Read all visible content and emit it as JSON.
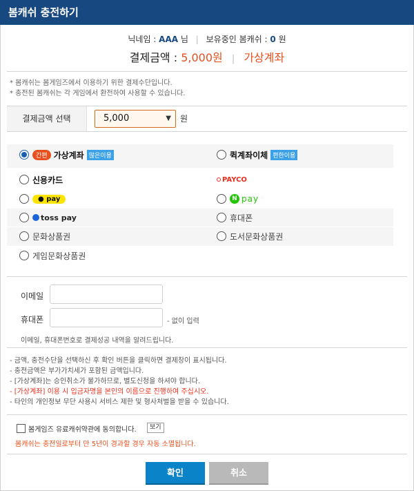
{
  "header": {
    "title": "봄캐쉬 충전하기"
  },
  "info": {
    "nickname_label": "닉네임 :",
    "nickname_value": "AAA",
    "nickname_suffix": "님",
    "cash_label": "보유중인 봄캐쉬 :",
    "cash_value": "0",
    "cash_unit": "원"
  },
  "payment": {
    "label": "결제금액 :",
    "amount": "5,000원",
    "method": "가상계좌"
  },
  "notes": [
    "* 봄캐쉬는 봄게임즈에서 이용하기 위한 결제수단입니다.",
    "* 충전된 봄캐쉬는 각 게임에서 환전하여 사용할 수 있습니다."
  ],
  "amount_select": {
    "label": "결제금액 선택",
    "value": "5,000",
    "unit": "원"
  },
  "methods": {
    "virtual_account": {
      "tag": "간편",
      "label": "가상계좌",
      "badge": "많은이용",
      "selected": true
    },
    "quick_transfer": {
      "label": "퀵계좌이체",
      "badge": "편한이용"
    },
    "credit_card": {
      "label": "신용카드"
    },
    "payco": {
      "label": "PAYCO"
    },
    "kakaopay": {
      "label": "pay"
    },
    "naverpay": {
      "n": "N",
      "label": "pay"
    },
    "tosspay": {
      "label": "toss pay"
    },
    "mobile": {
      "label": "휴대폰"
    },
    "culture_voucher": {
      "label": "문화상품권"
    },
    "book_voucher": {
      "label": "도서문화상품권"
    },
    "game_voucher": {
      "label": "게임문화상품권"
    }
  },
  "contact": {
    "email_label": "이메일",
    "phone_label": "휴대폰",
    "phone_hint": "- 없이 입력",
    "notice": "이메일, 휴대폰번호로 결제성공 내역을 알려드립니다."
  },
  "guides": [
    "- 금액, 충전수단을 선택하신 후 확인 버튼을 클릭하면 결제창이 표시됩니다.",
    "- 충전금액은 부가가치세가 포함된 금액입니다.",
    "- [가상계좌]는 승인취소가 불가하므로, 별도신청을 하셔야 합니다.",
    "- [가상계좌] 이용 시 입금자명을 본인의 이름으로 진행하여 주십시오.",
    "- 타인의 개인정보 무단 사용시 서비스 제한 및 형사처벌을 받을 수 있습니다."
  ],
  "agreement": {
    "label": "봄게임즈 유료캐쉬약관에 동의합니다.",
    "view_button": "보기",
    "expiry_notice": "봄캐쉬는 충전일로부터 만 5년이 경과할 경우 자동 소멸됩니다."
  },
  "buttons": {
    "confirm": "확인",
    "cancel": "취소"
  },
  "colors": {
    "header_bg": "#17487f",
    "accent_orange": "#e8501e",
    "confirm_blue": "#0a83c9",
    "cancel_gray": "#b9b9b9"
  }
}
